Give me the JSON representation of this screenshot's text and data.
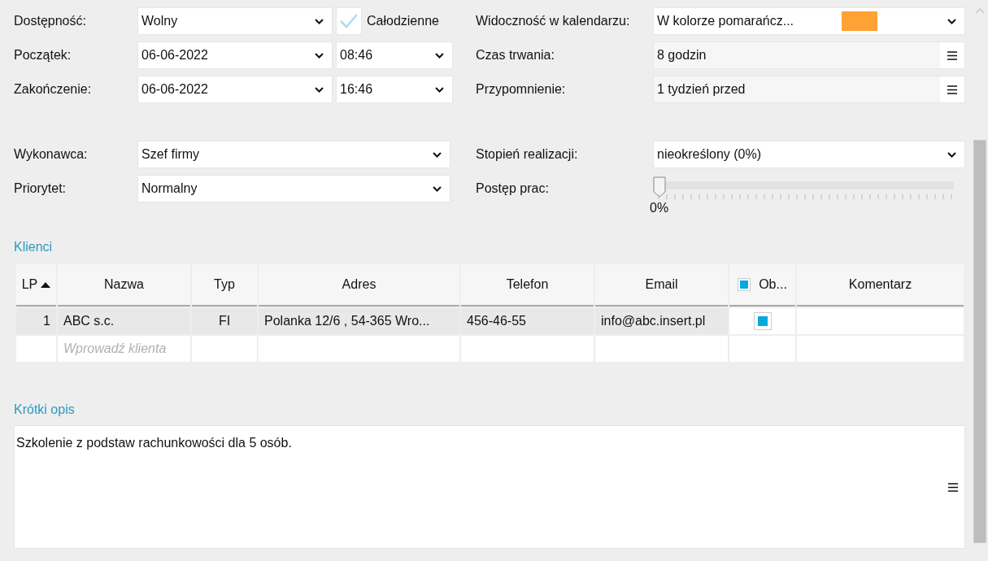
{
  "availability": {
    "label": "Dostępność:",
    "value": "Wolny"
  },
  "all_day": {
    "label": "Całodzienne",
    "checked": true
  },
  "start": {
    "label": "Początek:",
    "date": "06-06-2022",
    "time": "08:46"
  },
  "end": {
    "label": "Zakończenie:",
    "date": "06-06-2022",
    "time": "16:46"
  },
  "calendar_visibility": {
    "label": "Widoczność w kalendarzu:",
    "value": "W kolorze pomarańcz...",
    "color": "#ffa133"
  },
  "duration": {
    "label": "Czas trwania:",
    "value": "8 godzin"
  },
  "reminder": {
    "label": "Przypomnienie:",
    "value": "1 tydzień przed"
  },
  "assignee": {
    "label": "Wykonawca:",
    "value": "Szef firmy"
  },
  "priority": {
    "label": "Priorytet:",
    "value": "Normalny"
  },
  "completion": {
    "label": "Stopień realizacji:",
    "value": "nieokreślony  (0%)"
  },
  "progress": {
    "label": "Postęp prac:",
    "level": 0,
    "reading": "0%"
  },
  "clients": {
    "title": "Klienci",
    "columns": [
      {
        "label": "LP",
        "sorted": true,
        "kind": "text",
        "editable": false
      },
      {
        "label": "Nazwa",
        "sorted": false,
        "kind": "text",
        "editable": false
      },
      {
        "label": "Typ",
        "sorted": false,
        "kind": "text",
        "editable": false
      },
      {
        "label": "Adres",
        "sorted": false,
        "kind": "text",
        "editable": false
      },
      {
        "label": "Telefon",
        "sorted": false,
        "kind": "text",
        "editable": false
      },
      {
        "label": "Email",
        "sorted": false,
        "kind": "text",
        "editable": false
      },
      {
        "label": "Ob...",
        "sorted": false,
        "kind": "check",
        "checked": true,
        "editable": true
      },
      {
        "label": "Komentarz",
        "sorted": false,
        "kind": "text",
        "editable": true
      }
    ],
    "rows": [
      {
        "cells": [
          "1",
          "ABC s.c.",
          "FI",
          "Polanka  12/6 , 54-365 Wro...",
          "456-46-55",
          "info@abc.insert.pl"
        ],
        "checked": true
      }
    ],
    "new_row_placeholder": "Wprowadź klienta"
  },
  "description": {
    "title": "Krótki opis",
    "value": "Szkolenie z podstaw rachunkowości dla 5 osób."
  }
}
